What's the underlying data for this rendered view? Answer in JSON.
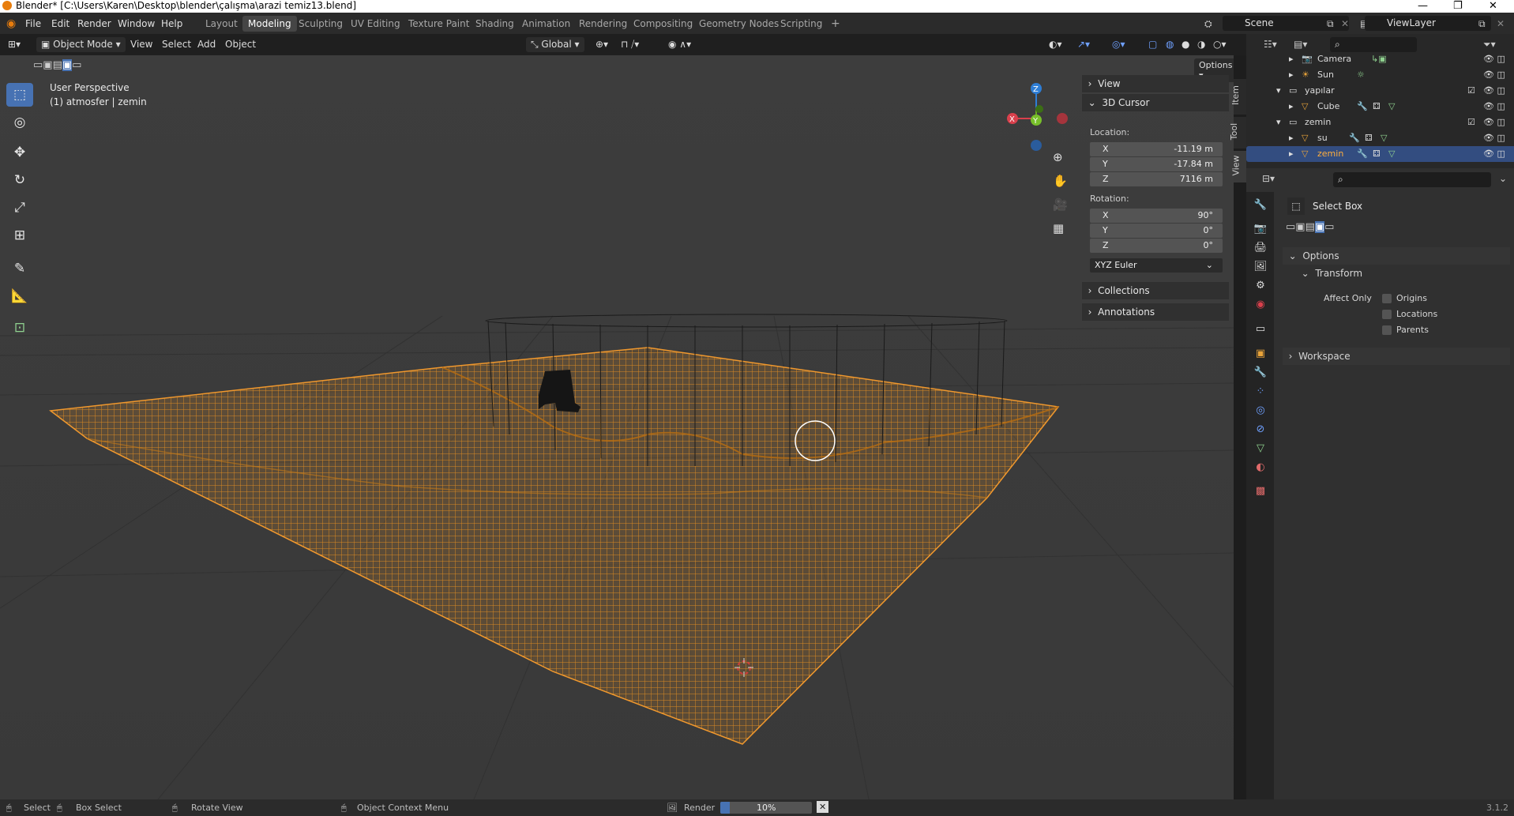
{
  "window": {
    "title": "Blender* [C:\\Users\\Karen\\Desktop\\blender\\çalışma\\arazi temiz13.blend]",
    "minimize": "—",
    "restore": "❐",
    "close": "✕"
  },
  "menu": {
    "file": "File",
    "edit": "Edit",
    "render": "Render",
    "window": "Window",
    "help": "Help"
  },
  "workspaces": [
    "Layout",
    "Modeling",
    "Sculpting",
    "UV Editing",
    "Texture Paint",
    "Shading",
    "Animation",
    "Rendering",
    "Compositing",
    "Geometry Nodes",
    "Scripting"
  ],
  "active_workspace": "Modeling",
  "scene": {
    "name": "Scene",
    "view_layer": "ViewLayer"
  },
  "viewport_header": {
    "mode": "Object Mode",
    "view": "View",
    "select": "Select",
    "add": "Add",
    "object": "Object",
    "orientation": "Global",
    "options": "Options"
  },
  "viewport": {
    "perspective": "User Perspective",
    "collection_info": "(1) atmosfer | zemin",
    "gizmo_axes": {
      "x": "X",
      "y": "Y",
      "z": "Z"
    }
  },
  "npanel": {
    "view": "View",
    "cursor": "3D Cursor",
    "location_label": "Location:",
    "location": [
      {
        "axis": "X",
        "value": "-11.19 m"
      },
      {
        "axis": "Y",
        "value": "-17.84 m"
      },
      {
        "axis": "Z",
        "value": "7116 m"
      }
    ],
    "rotation_label": "Rotation:",
    "rotation": [
      {
        "axis": "X",
        "value": "90°"
      },
      {
        "axis": "Y",
        "value": "0°"
      },
      {
        "axis": "Z",
        "value": "0°"
      }
    ],
    "rotation_mode": "XYZ Euler",
    "collections": "Collections",
    "annotations": "Annotations",
    "tabs": [
      "Item",
      "Tool",
      "View"
    ]
  },
  "outliner": {
    "rows": [
      {
        "name": "Camera",
        "indent": 2
      },
      {
        "name": "Sun",
        "indent": 2
      },
      {
        "name": "yapılar",
        "indent": 1
      },
      {
        "name": "Cube",
        "indent": 2
      },
      {
        "name": "zemin",
        "indent": 1
      },
      {
        "name": "su",
        "indent": 2
      },
      {
        "name": "zemin",
        "indent": 2
      }
    ]
  },
  "properties": {
    "tool_name": "Select Box",
    "options": "Options",
    "transform": "Transform",
    "affect_only": "Affect Only",
    "checkboxes": [
      "Origins",
      "Locations",
      "Parents"
    ],
    "workspace": "Workspace"
  },
  "statusbar": {
    "select": "Select",
    "box_select": "Box Select",
    "rotate_view": "Rotate View",
    "context_menu": "Object Context Menu",
    "render": "Render",
    "progress_text": "10%",
    "progress": 0.1,
    "version": "3.1.2"
  }
}
